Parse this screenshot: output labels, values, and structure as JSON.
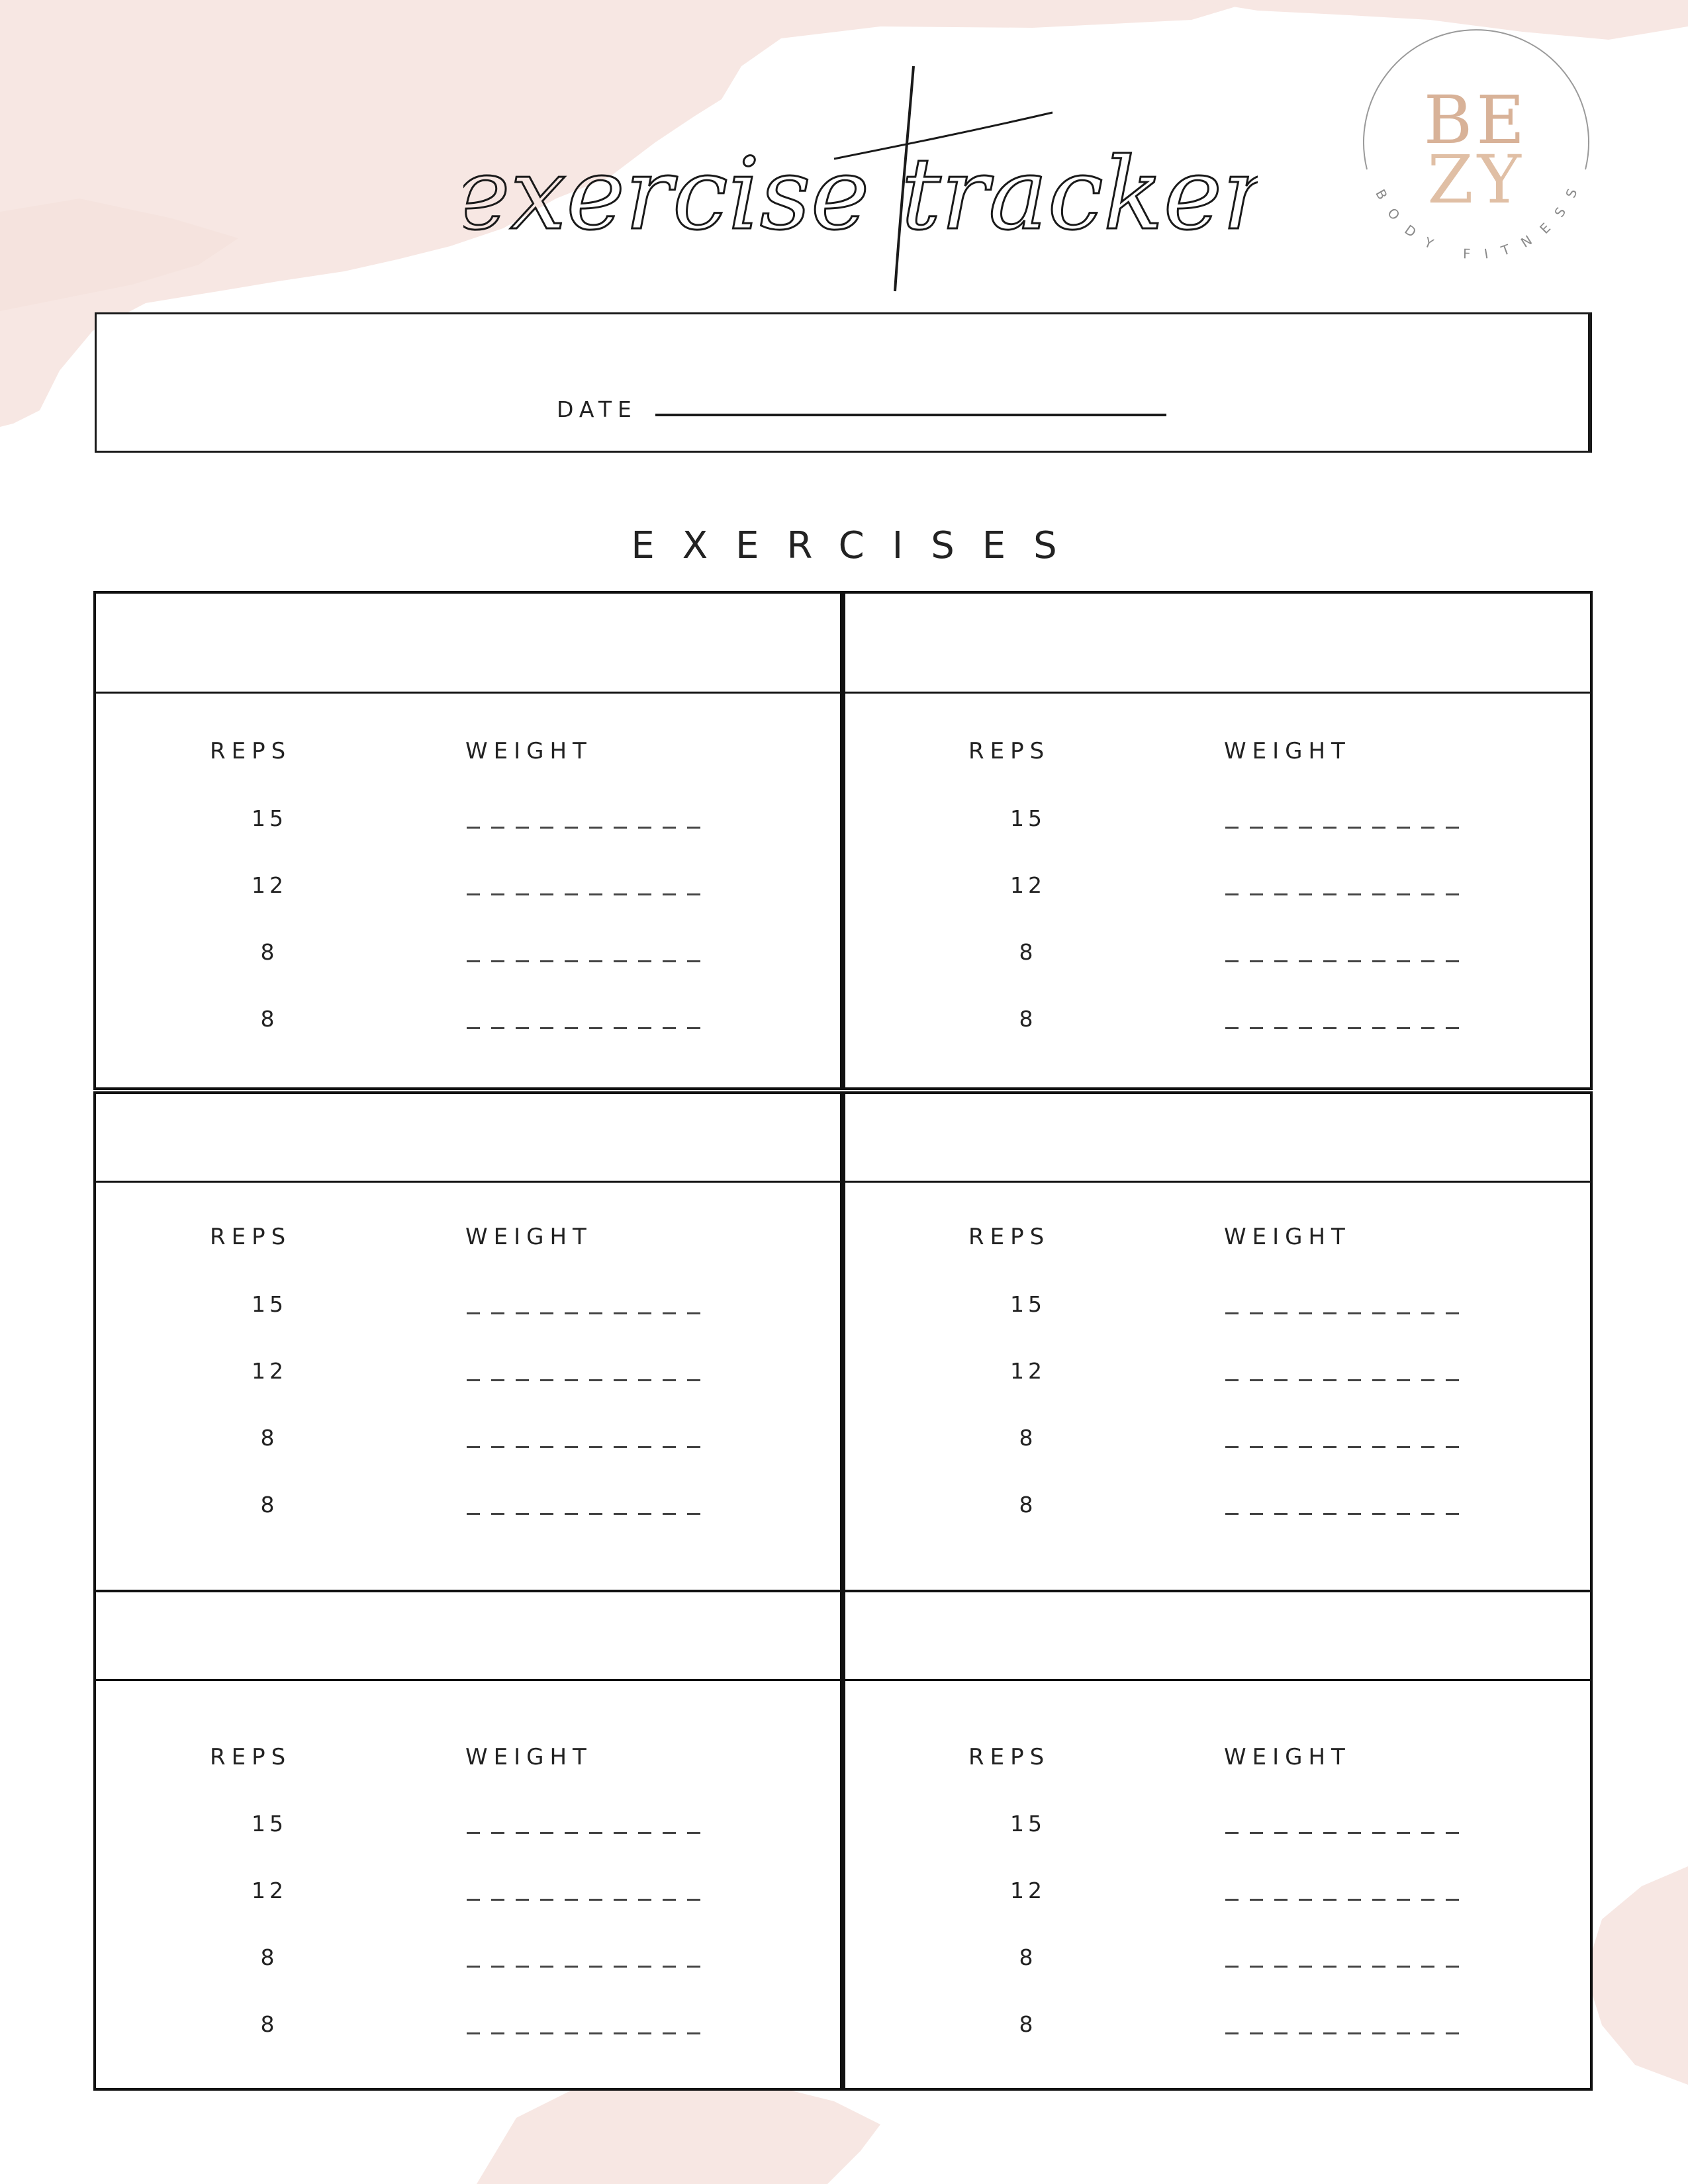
{
  "page": {
    "title": "exercise tracker",
    "logo": {
      "line1": "BE",
      "line2": "ZY",
      "ring_text": "BODY FITNESS"
    },
    "colors": {
      "wash": "#f6e6e2",
      "ink": "#1a1a1a",
      "logo_gold": "#d8b298"
    }
  },
  "date_section": {
    "label": "DATE"
  },
  "exercises": {
    "heading": "EXERCISES",
    "cards": [
      {
        "reps_header": "REPS",
        "weight_header": "WEIGHT",
        "rows": [
          {
            "reps": "15"
          },
          {
            "reps": "12"
          },
          {
            "reps": "8"
          },
          {
            "reps": "8"
          }
        ]
      },
      {
        "reps_header": "REPS",
        "weight_header": "WEIGHT",
        "rows": [
          {
            "reps": "15"
          },
          {
            "reps": "12"
          },
          {
            "reps": "8"
          },
          {
            "reps": "8"
          }
        ]
      },
      {
        "reps_header": "REPS",
        "weight_header": "WEIGHT",
        "rows": [
          {
            "reps": "15"
          },
          {
            "reps": "12"
          },
          {
            "reps": "8"
          },
          {
            "reps": "8"
          }
        ]
      },
      {
        "reps_header": "REPS",
        "weight_header": "WEIGHT",
        "rows": [
          {
            "reps": "15"
          },
          {
            "reps": "12"
          },
          {
            "reps": "8"
          },
          {
            "reps": "8"
          }
        ]
      },
      {
        "reps_header": "REPS",
        "weight_header": "WEIGHT",
        "rows": [
          {
            "reps": "15"
          },
          {
            "reps": "12"
          },
          {
            "reps": "8"
          },
          {
            "reps": "8"
          }
        ]
      },
      {
        "reps_header": "REPS",
        "weight_header": "WEIGHT",
        "rows": [
          {
            "reps": "15"
          },
          {
            "reps": "12"
          },
          {
            "reps": "8"
          },
          {
            "reps": "8"
          }
        ]
      }
    ]
  }
}
